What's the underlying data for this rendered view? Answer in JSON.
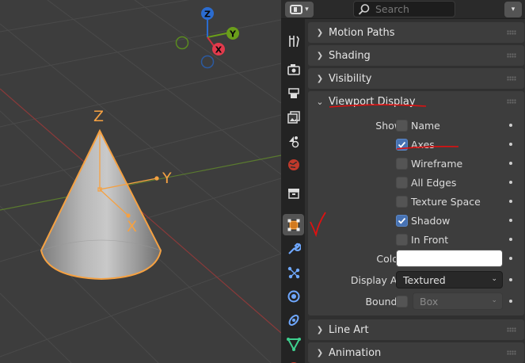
{
  "viewport": {
    "gizmo": {
      "z": "Z",
      "y": "Y",
      "x": "X"
    },
    "object_axes": {
      "z": "Z",
      "y": "Y",
      "x": "X"
    }
  },
  "header": {
    "search_placeholder": "Search"
  },
  "tabs": [
    {
      "name": "tool-tab",
      "icon": "tool-icon"
    },
    {
      "name": "render-tab",
      "icon": "render-icon"
    },
    {
      "name": "output-tab",
      "icon": "output-icon"
    },
    {
      "name": "view-layer-tab",
      "icon": "view-layer-icon"
    },
    {
      "name": "scene-tab",
      "icon": "scene-icon"
    },
    {
      "name": "world-tab",
      "icon": "world-icon"
    },
    {
      "name": "collection-tab",
      "icon": "collection-icon"
    },
    {
      "name": "object-tab",
      "icon": "object-icon",
      "active": true
    },
    {
      "name": "modifiers-tab",
      "icon": "wrench-icon"
    },
    {
      "name": "particles-tab",
      "icon": "particles-icon"
    },
    {
      "name": "physics-tab",
      "icon": "physics-icon"
    },
    {
      "name": "constraints-tab",
      "icon": "constraints-icon"
    },
    {
      "name": "data-tab",
      "icon": "mesh-data-icon"
    },
    {
      "name": "material-tab",
      "icon": "material-icon"
    }
  ],
  "panels": {
    "motion_paths": "Motion Paths",
    "shading": "Shading",
    "visibility": "Visibility",
    "viewport_display": "Viewport Display",
    "line_art": "Line Art",
    "animation": "Animation"
  },
  "viewport_display": {
    "show_label": "Show",
    "checkboxes": [
      {
        "label": "Name",
        "checked": false
      },
      {
        "label": "Axes",
        "checked": true
      },
      {
        "label": "Wireframe",
        "checked": false
      },
      {
        "label": "All Edges",
        "checked": false
      },
      {
        "label": "Texture Space",
        "checked": false
      },
      {
        "label": "Shadow",
        "checked": true
      },
      {
        "label": "In Front",
        "checked": false
      }
    ],
    "color_label": "Color",
    "color_value": "#ffffff",
    "display_as_label": "Display As",
    "display_as_value": "Textured",
    "bounds_label": "Bounds",
    "bounds_checked": false,
    "bounds_value": "Box"
  },
  "colors": {
    "accent": "#4772b3",
    "selection_orange": "#f5a142",
    "annotation_red": "#e01010"
  }
}
